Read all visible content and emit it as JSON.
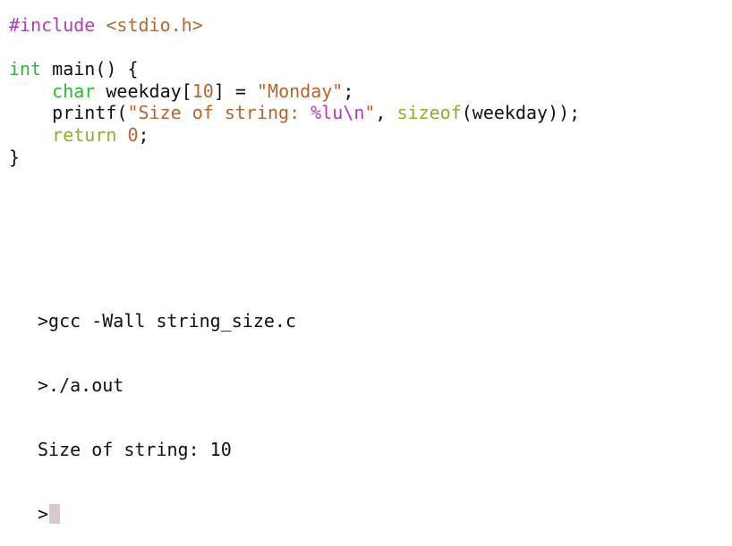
{
  "colors": {
    "preprocessor": "#b03db8",
    "include_file": "#b5662e",
    "type_keyword": "#2eb82e",
    "keyword": "#8fae2a",
    "number": "#b5662e",
    "string": "#b5662e",
    "format_escape": "#b03db8",
    "builtin": "#8fae2a",
    "plain": "#111111",
    "cursor": "#d8c8d0"
  },
  "editor": {
    "lines": [
      [
        {
          "text": "#include",
          "color": "preprocessor"
        },
        {
          "text": " ",
          "color": "plain"
        },
        {
          "text": "<stdio.h>",
          "color": "include_file"
        }
      ],
      [],
      [
        {
          "text": "int",
          "color": "type_keyword"
        },
        {
          "text": " main() {",
          "color": "plain"
        }
      ],
      [
        {
          "text": "    ",
          "color": "plain"
        },
        {
          "text": "char",
          "color": "type_keyword"
        },
        {
          "text": " weekday[",
          "color": "plain"
        },
        {
          "text": "10",
          "color": "number"
        },
        {
          "text": "] = ",
          "color": "plain"
        },
        {
          "text": "\"Monday\"",
          "color": "string"
        },
        {
          "text": ";",
          "color": "plain"
        }
      ],
      [
        {
          "text": "    printf(",
          "color": "plain"
        },
        {
          "text": "\"Size of string: ",
          "color": "string"
        },
        {
          "text": "%lu\\n",
          "color": "format_escape"
        },
        {
          "text": "\"",
          "color": "string"
        },
        {
          "text": ", ",
          "color": "plain"
        },
        {
          "text": "sizeof",
          "color": "builtin"
        },
        {
          "text": "(weekday));",
          "color": "plain"
        }
      ],
      [
        {
          "text": "    ",
          "color": "plain"
        },
        {
          "text": "return",
          "color": "keyword"
        },
        {
          "text": " ",
          "color": "plain"
        },
        {
          "text": "0",
          "color": "number"
        },
        {
          "text": ";",
          "color": "plain"
        }
      ],
      [
        {
          "text": "}",
          "color": "plain"
        }
      ]
    ]
  },
  "terminal": {
    "lines": [
      ">gcc -Wall string_size.c",
      ">./a.out",
      "Size of string: 10"
    ],
    "prompt": ">"
  }
}
